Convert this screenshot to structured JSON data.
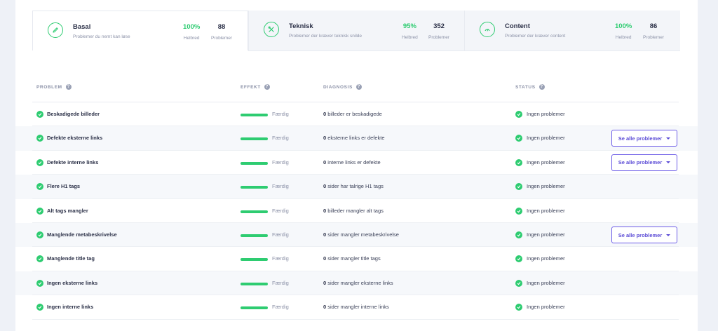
{
  "tabs": [
    {
      "name": "Basal",
      "desc": "Problemer du nemt kan løse",
      "pct": "100%",
      "pct_label": "Helbred",
      "count": "88",
      "count_label": "Problemer",
      "icon": "pencil-icon"
    },
    {
      "name": "Teknisk",
      "desc": "Problemer der kræver teknisk snilde",
      "pct": "95%",
      "pct_label": "Helbred",
      "count": "352",
      "count_label": "Problemer",
      "icon": "tools-icon"
    },
    {
      "name": "Content",
      "desc": "Problemer der kræver content",
      "pct": "100%",
      "pct_label": "Helbred",
      "count": "86",
      "count_label": "Problemer",
      "icon": "gauge-icon"
    }
  ],
  "table": {
    "headers": {
      "problem": "PROBLEM",
      "effekt": "EFFEKT",
      "diagnosis": "DIAGNOSIS",
      "status": "STATUS"
    },
    "rows": [
      {
        "problem": "Beskadigede billeder",
        "effekt": "Færdig",
        "diag_count": "0",
        "diag_text": " billeder er beskadigede",
        "status": "Ingen problemer",
        "action": ""
      },
      {
        "problem": "Defekte eksterne links",
        "effekt": "Færdig",
        "diag_count": "0",
        "diag_text": " eksterne links er defekte",
        "status": "Ingen problemer",
        "action": "Se alle problemer"
      },
      {
        "problem": "Defekte interne links",
        "effekt": "Færdig",
        "diag_count": "0",
        "diag_text": " interne links er defekte",
        "status": "Ingen problemer",
        "action": "Se alle problemer"
      },
      {
        "problem": "Flere H1 tags",
        "effekt": "Færdig",
        "diag_count": "0",
        "diag_text": " sider har talrige H1 tags",
        "status": "Ingen problemer",
        "action": ""
      },
      {
        "problem": "Alt tags mangler",
        "effekt": "Færdig",
        "diag_count": "0",
        "diag_text": " billeder mangler alt tags",
        "status": "Ingen problemer",
        "action": ""
      },
      {
        "problem": "Manglende metabeskrivelse",
        "effekt": "Færdig",
        "diag_count": "0",
        "diag_text": " sider mangler metabeskrivelse",
        "status": "Ingen problemer",
        "action": "Se alle problemer"
      },
      {
        "problem": "Manglende title tag",
        "effekt": "Færdig",
        "diag_count": "0",
        "diag_text": " sider mangler title tags",
        "status": "Ingen problemer",
        "action": ""
      },
      {
        "problem": "Ingen eksterne links",
        "effekt": "Færdig",
        "diag_count": "0",
        "diag_text": " sider mangler eksterne links",
        "status": "Ingen problemer",
        "action": ""
      },
      {
        "problem": "Ingen interne links",
        "effekt": "Færdig",
        "diag_count": "0",
        "diag_text": " sider mangler interne links",
        "status": "Ingen problemer",
        "action": ""
      }
    ]
  },
  "colors": {
    "accent": "#6c5ce7",
    "success": "#2ecc71",
    "text": "#2c3148",
    "muted": "#8b91a7"
  }
}
